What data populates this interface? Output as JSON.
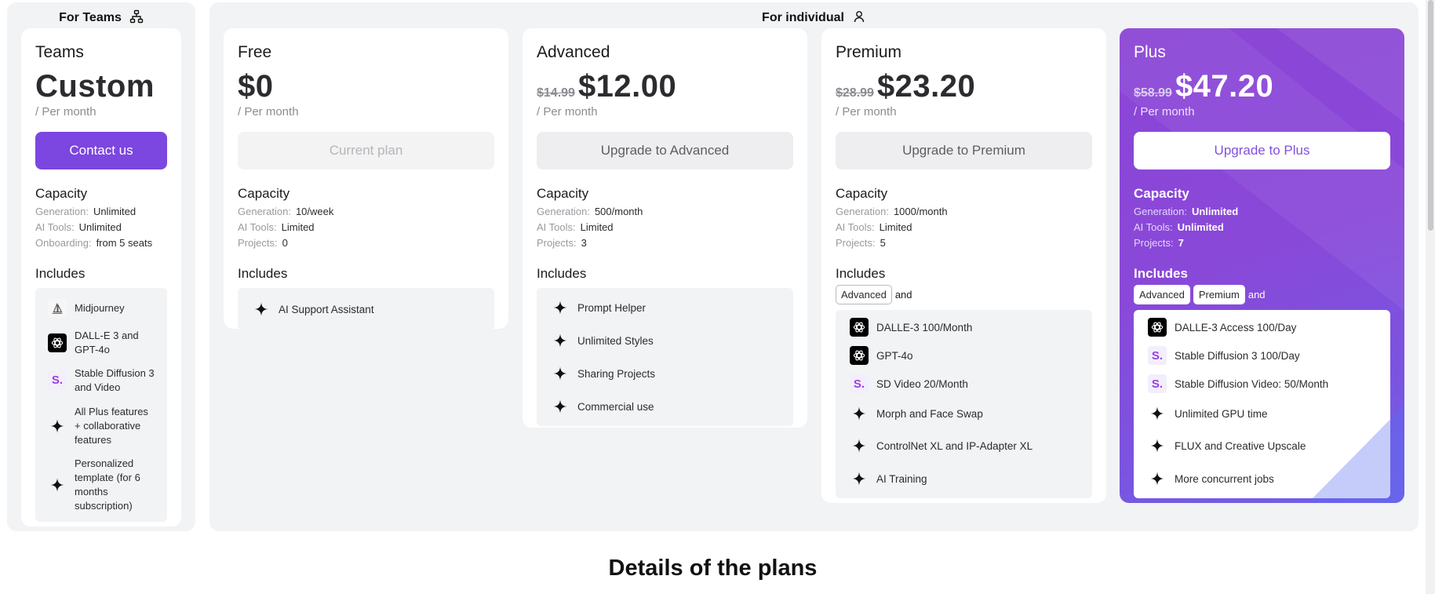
{
  "teams_panel": {
    "title": "For Teams",
    "icon": "org-chart-icon"
  },
  "individual_panel": {
    "title": "For individual",
    "icon": "user-icon"
  },
  "teams": {
    "name": "Teams",
    "price": "Custom",
    "per": "/ Per month",
    "cta": "Contact us",
    "capacity_title": "Capacity",
    "capacity": [
      {
        "k": "Generation:",
        "v": "Unlimited"
      },
      {
        "k": "AI Tools:",
        "v": "Unlimited"
      },
      {
        "k": "Onboarding:",
        "v": "from 5 seats"
      }
    ],
    "includes_title": "Includes",
    "includes": [
      {
        "icon": "midjourney-icon",
        "text": "Midjourney"
      },
      {
        "icon": "openai-icon",
        "text": "DALL-E 3 and GPT-4o"
      },
      {
        "icon": "stable-diffusion-icon",
        "text": "Stable Diffusion 3 and Video"
      },
      {
        "icon": "sparkle-icon",
        "text": "All Plus features + collaborative features"
      },
      {
        "icon": "sparkle-icon",
        "text": "Personalized template (for 6 months subscription)"
      }
    ]
  },
  "free": {
    "name": "Free",
    "price": "$0",
    "per": "/ Per month",
    "cta": "Current plan",
    "capacity_title": "Capacity",
    "capacity": [
      {
        "k": "Generation:",
        "v": "10/week"
      },
      {
        "k": "AI Tools:",
        "v": "Limited"
      },
      {
        "k": "Projects:",
        "v": "0"
      }
    ],
    "includes_title": "Includes",
    "includes": [
      {
        "icon": "sparkle-icon",
        "text": "AI Support Assistant"
      }
    ]
  },
  "advanced": {
    "name": "Advanced",
    "old_price": "$14.99",
    "price": "$12.00",
    "per": "/ Per month",
    "cta": "Upgrade to Advanced",
    "capacity_title": "Capacity",
    "capacity": [
      {
        "k": "Generation:",
        "v": "500/month"
      },
      {
        "k": "AI Tools:",
        "v": "Limited"
      },
      {
        "k": "Projects:",
        "v": "3"
      }
    ],
    "includes_title": "Includes",
    "includes": [
      {
        "icon": "sparkle-icon",
        "text": "Prompt Helper"
      },
      {
        "icon": "sparkle-icon",
        "text": "Unlimited Styles"
      },
      {
        "icon": "sparkle-icon",
        "text": "Sharing Projects"
      },
      {
        "icon": "sparkle-icon",
        "text": "Commercial use"
      }
    ]
  },
  "premium": {
    "name": "Premium",
    "old_price": "$28.99",
    "price": "$23.20",
    "per": "/ Per month",
    "cta": "Upgrade to Premium",
    "capacity_title": "Capacity",
    "capacity": [
      {
        "k": "Generation:",
        "v": "1000/month"
      },
      {
        "k": "AI Tools:",
        "v": "Limited"
      },
      {
        "k": "Projects:",
        "v": "5"
      }
    ],
    "includes_title": "Includes",
    "tags": [
      "Advanced"
    ],
    "and": "and",
    "includes": [
      {
        "icon": "openai-icon",
        "text": "DALLE-3 100/Month"
      },
      {
        "icon": "openai-icon",
        "text": "GPT-4o"
      },
      {
        "icon": "stable-diffusion-icon",
        "text": "SD Video 20/Month"
      },
      {
        "icon": "sparkle-icon",
        "text": "Morph and Face Swap"
      },
      {
        "icon": "sparkle-icon",
        "text": "ControlNet XL and IP-Adapter XL"
      },
      {
        "icon": "sparkle-icon",
        "text": "AI Training"
      }
    ]
  },
  "plus": {
    "name": "Plus",
    "old_price": "$58.99",
    "price": "$47.20",
    "per": "/ Per month",
    "cta": "Upgrade to Plus",
    "capacity_title": "Capacity",
    "capacity": [
      {
        "k": "Generation:",
        "v": "Unlimited"
      },
      {
        "k": "AI Tools:",
        "v": "Unlimited"
      },
      {
        "k": "Projects:",
        "v": "7"
      }
    ],
    "includes_title": "Includes",
    "tags": [
      "Advanced",
      "Premium"
    ],
    "and": "and",
    "includes": [
      {
        "icon": "openai-icon",
        "text": "DALLE-3 Access 100/Day"
      },
      {
        "icon": "stable-diffusion-icon",
        "text": "Stable Diffusion 3 100/Day"
      },
      {
        "icon": "stable-diffusion-icon",
        "text": "Stable Diffusion Video: 50/Month"
      },
      {
        "icon": "sparkle-icon",
        "text": "Unlimited GPU time"
      },
      {
        "icon": "sparkle-icon",
        "text": "FLUX and Creative Upscale"
      },
      {
        "icon": "sparkle-icon",
        "text": "More concurrent jobs"
      }
    ]
  },
  "details_title": "Details of the plans",
  "sd_glyph": "S.",
  "colors": {
    "accent": "#7c46e0",
    "plus_gradient_start": "#8b45d6",
    "plus_gradient_end": "#6f62ea",
    "panel_bg": "#f2f3f5"
  }
}
